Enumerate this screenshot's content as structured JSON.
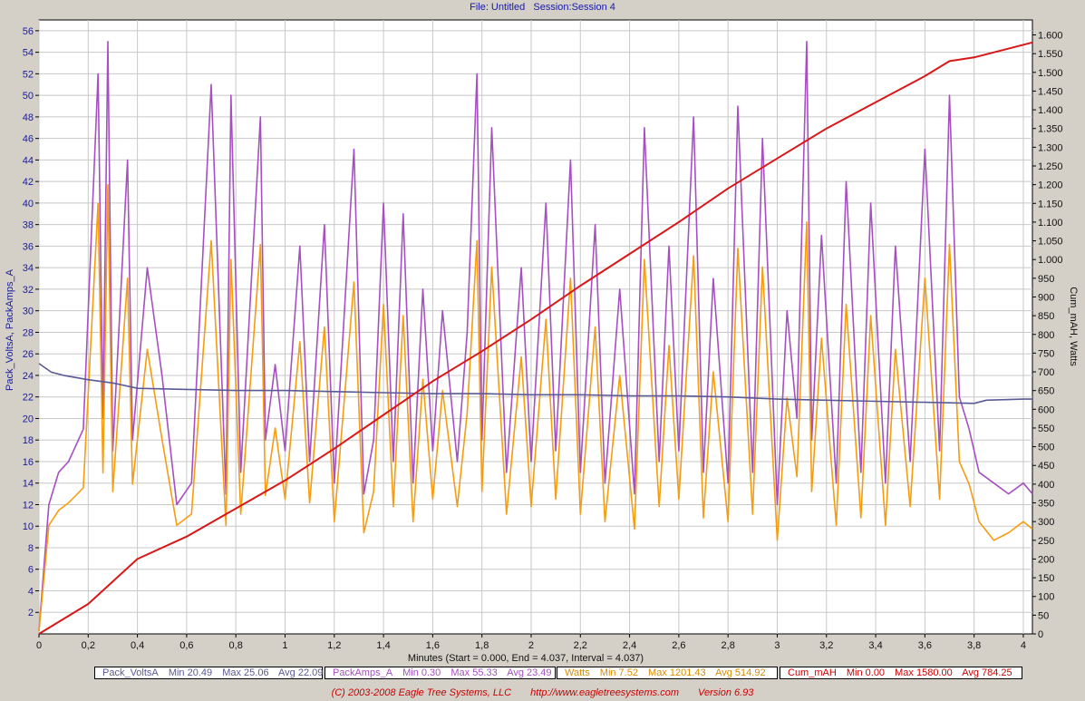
{
  "header": {
    "file": "File: Untitled",
    "session": "Session:Session 4"
  },
  "chart_data": {
    "type": "line",
    "title": "File: Untitled   Session:Session 4",
    "xlabel": "Minutes (Start = 0.000,  End = 4.037,  Interval =  4.037)",
    "ylabel_left": "Pack_VoltsA, PackAmps_A",
    "ylabel_right": "Cum_mAH, Watts",
    "xlim": [
      0,
      4.037
    ],
    "ylim_left": [
      0,
      57
    ],
    "ylim_right": [
      0,
      1.64
    ],
    "grid": true,
    "x_ticks": [
      "0",
      "0,2",
      "0,4",
      "0,6",
      "0,8",
      "1",
      "1,2",
      "1,4",
      "1,6",
      "1,8",
      "2",
      "2,2",
      "2,4",
      "2,6",
      "2,8",
      "3",
      "3,2",
      "3,4",
      "3,6",
      "3,8",
      "4"
    ],
    "left_ticks": [
      "2",
      "4",
      "6",
      "8",
      "10",
      "12",
      "14",
      "16",
      "18",
      "20",
      "22",
      "24",
      "26",
      "28",
      "30",
      "32",
      "34",
      "36",
      "38",
      "40",
      "42",
      "44",
      "46",
      "48",
      "50",
      "52",
      "54",
      "56"
    ],
    "right_ticks": [
      "0",
      "50",
      "100",
      "150",
      "200",
      "250",
      "300",
      "350",
      "400",
      "450",
      "500",
      "550",
      "600",
      "650",
      "700",
      "750",
      "800",
      "850",
      "900",
      "950",
      "1.000",
      "1.050",
      "1.100",
      "1.150",
      "1.200",
      "1.250",
      "1.300",
      "1.350",
      "1.400",
      "1.450",
      "1.500",
      "1.550",
      "1.600"
    ],
    "right_tick_values": [
      0,
      50,
      100,
      150,
      200,
      250,
      300,
      350,
      400,
      450,
      500,
      550,
      600,
      650,
      700,
      750,
      800,
      850,
      900,
      950,
      1000,
      1050,
      1100,
      1150,
      1200,
      1250,
      1300,
      1350,
      1400,
      1450,
      1500,
      1550,
      1600
    ],
    "series": [
      {
        "name": "Pack_VoltsA",
        "axis": "left",
        "color": "#5a5a96",
        "x": [
          0,
          0.05,
          0.1,
          0.2,
          0.3,
          0.4,
          0.6,
          0.8,
          1.0,
          1.2,
          1.4,
          1.6,
          1.8,
          2.0,
          2.2,
          2.4,
          2.6,
          2.8,
          3.0,
          3.2,
          3.4,
          3.6,
          3.8,
          3.85,
          4.0,
          4.037
        ],
        "y": [
          25.1,
          24.3,
          24.0,
          23.6,
          23.3,
          22.8,
          22.7,
          22.6,
          22.6,
          22.5,
          22.4,
          22.3,
          22.3,
          22.2,
          22.2,
          22.1,
          22.1,
          22.0,
          21.8,
          21.7,
          21.6,
          21.5,
          21.4,
          21.7,
          21.8,
          21.8
        ]
      },
      {
        "name": "PackAmps_A",
        "axis": "left",
        "color": "#a64fc2",
        "x": [
          0,
          0.04,
          0.08,
          0.12,
          0.18,
          0.24,
          0.26,
          0.28,
          0.3,
          0.36,
          0.38,
          0.44,
          0.5,
          0.56,
          0.62,
          0.7,
          0.76,
          0.78,
          0.82,
          0.9,
          0.92,
          0.96,
          1.0,
          1.06,
          1.1,
          1.16,
          1.2,
          1.28,
          1.32,
          1.36,
          1.4,
          1.44,
          1.48,
          1.52,
          1.56,
          1.6,
          1.64,
          1.7,
          1.74,
          1.78,
          1.8,
          1.84,
          1.9,
          1.96,
          2.0,
          2.06,
          2.1,
          2.16,
          2.2,
          2.26,
          2.3,
          2.36,
          2.42,
          2.46,
          2.52,
          2.56,
          2.6,
          2.66,
          2.7,
          2.74,
          2.8,
          2.84,
          2.9,
          2.94,
          3.0,
          3.04,
          3.08,
          3.12,
          3.14,
          3.18,
          3.24,
          3.28,
          3.34,
          3.38,
          3.44,
          3.48,
          3.54,
          3.6,
          3.66,
          3.7,
          3.74,
          3.78,
          3.82,
          3.88,
          3.94,
          4.0,
          4.037
        ],
        "y": [
          0.3,
          12,
          15,
          16,
          19,
          52,
          20,
          55,
          17,
          44,
          18,
          34,
          24,
          12,
          14,
          51,
          13,
          50,
          15,
          48,
          18,
          25,
          17,
          36,
          16,
          38,
          14,
          45,
          13,
          18,
          40,
          16,
          39,
          14,
          32,
          17,
          30,
          16,
          28,
          52,
          18,
          47,
          15,
          34,
          16,
          40,
          17,
          44,
          15,
          38,
          14,
          32,
          13,
          47,
          16,
          36,
          17,
          48,
          15,
          33,
          14,
          49,
          15,
          46,
          12,
          30,
          20,
          55,
          18,
          37,
          14,
          42,
          15,
          40,
          14,
          36,
          16,
          45,
          17,
          50,
          22,
          19,
          15,
          14,
          13,
          14,
          13
        ]
      },
      {
        "name": "Watts",
        "axis": "right",
        "color": "#f59c10",
        "x": [
          0,
          0.04,
          0.08,
          0.12,
          0.18,
          0.24,
          0.26,
          0.28,
          0.3,
          0.36,
          0.38,
          0.44,
          0.5,
          0.56,
          0.62,
          0.7,
          0.76,
          0.78,
          0.82,
          0.9,
          0.92,
          0.96,
          1.0,
          1.06,
          1.1,
          1.16,
          1.2,
          1.28,
          1.32,
          1.36,
          1.4,
          1.44,
          1.48,
          1.52,
          1.56,
          1.6,
          1.64,
          1.7,
          1.74,
          1.78,
          1.8,
          1.84,
          1.9,
          1.96,
          2.0,
          2.06,
          2.1,
          2.16,
          2.2,
          2.26,
          2.3,
          2.36,
          2.42,
          2.46,
          2.52,
          2.56,
          2.6,
          2.66,
          2.7,
          2.74,
          2.8,
          2.84,
          2.9,
          2.94,
          3.0,
          3.04,
          3.08,
          3.12,
          3.14,
          3.18,
          3.24,
          3.28,
          3.34,
          3.38,
          3.44,
          3.48,
          3.54,
          3.6,
          3.66,
          3.7,
          3.74,
          3.78,
          3.82,
          3.88,
          3.94,
          4.0,
          4.037
        ],
        "y": [
          7.5,
          290,
          330,
          350,
          390,
          1150,
          430,
          1200,
          380,
          950,
          400,
          760,
          520,
          290,
          320,
          1050,
          290,
          1000,
          320,
          1040,
          370,
          550,
          360,
          780,
          350,
          820,
          300,
          940,
          270,
          380,
          880,
          340,
          850,
          300,
          680,
          360,
          650,
          340,
          590,
          1050,
          380,
          980,
          320,
          740,
          340,
          840,
          360,
          950,
          320,
          820,
          300,
          690,
          280,
          1000,
          340,
          770,
          360,
          1010,
          310,
          700,
          300,
          1030,
          320,
          980,
          250,
          630,
          420,
          1100,
          380,
          790,
          290,
          880,
          310,
          850,
          290,
          760,
          340,
          950,
          360,
          1040,
          460,
          400,
          300,
          250,
          270,
          300,
          280
        ]
      },
      {
        "name": "Cum_mAH",
        "axis": "right",
        "color": "#d81818",
        "x": [
          0,
          0.2,
          0.3,
          0.4,
          0.6,
          0.8,
          1.0,
          1.2,
          1.4,
          1.6,
          1.8,
          2.0,
          2.2,
          2.4,
          2.6,
          2.8,
          3.0,
          3.2,
          3.4,
          3.6,
          3.7,
          3.8,
          4.037
        ],
        "y": [
          0,
          80,
          140,
          200,
          260,
          335,
          410,
          495,
          585,
          675,
          755,
          840,
          930,
          1015,
          1100,
          1190,
          1270,
          1350,
          1420,
          1490,
          1530,
          1540,
          1580
        ]
      }
    ]
  },
  "legend": [
    {
      "name": "Pack_VoltsA",
      "min": "Min 20.49",
      "max": "Max 25.06",
      "avg": "Avg 22.09",
      "color": "#5a5a96"
    },
    {
      "name": "PackAmps_A",
      "min": "Min 0.30",
      "max": "Max 55.33",
      "avg": "Avg 23.49",
      "color": "#a64fc2"
    },
    {
      "name": "Watts",
      "min": "Min 7.52",
      "max": "Max 1201.43",
      "avg": "Avg 514.92",
      "color": "#d98c00"
    },
    {
      "name": "Cum_mAH",
      "min": "Min 0.00",
      "max": "Max 1580.00",
      "avg": "Avg 784.25",
      "color": "#cc0000"
    }
  ],
  "footer": {
    "copyright": "(C) 2003-2008 Eagle Tree Systems, LLC",
    "url": "http://www.eagletreesystems.com",
    "version": "Version 6.93"
  }
}
